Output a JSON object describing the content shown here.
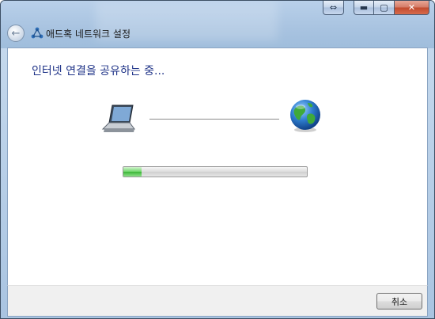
{
  "window": {
    "title": "애드혹 네트워크 설정",
    "caption_buttons": [
      "snap-icon",
      "minimize-icon",
      "maximize-icon",
      "close-icon"
    ]
  },
  "main": {
    "heading": "인터넷 연결을 공유하는 중...",
    "progress_fraction": 0.1
  },
  "footer": {
    "cancel_label": "취소"
  },
  "colors": {
    "heading": "#1e3287",
    "progress_fill": "#3bb537"
  }
}
